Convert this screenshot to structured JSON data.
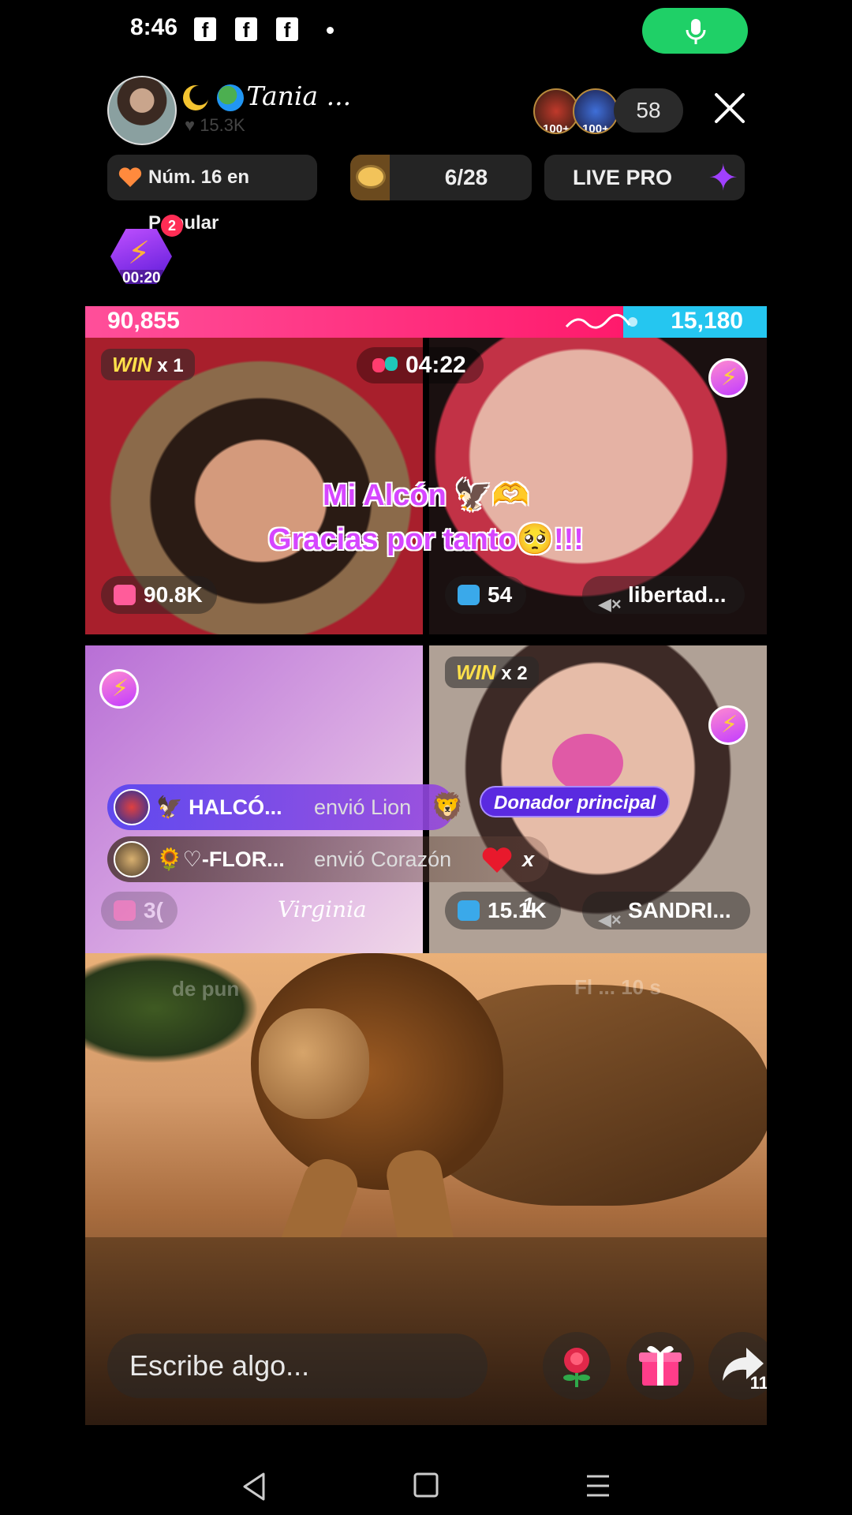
{
  "status_bar": {
    "time": "8:46",
    "notification_icons": [
      "f",
      "f",
      "f"
    ]
  },
  "host": {
    "name": "Tania ...",
    "likes": "15.3K",
    "viewer_badges": [
      "100+",
      "100+"
    ],
    "viewer_count": "58"
  },
  "pills": {
    "rank": "Núm. 16 en Popular",
    "planet_progress": "6/28",
    "live_pro": "LIVE PRO"
  },
  "boost": {
    "count": "2",
    "timer": "00:20"
  },
  "battle": {
    "score_left": "90,855",
    "score_right": "15,180",
    "timer": "04:22",
    "caption_line1": "Mi Alcón 🦅🫶",
    "caption_line2": "Gracias por tanto🥺!!!",
    "tiles": [
      {
        "win_label": "WIN",
        "win_count": "x 1",
        "coins": "90.8K"
      },
      {
        "coins": "54",
        "mute_name": "libertad..."
      },
      {
        "coins": "3(",
        "name": "Virginia"
      },
      {
        "win_label": "WIN",
        "win_count": "x 2",
        "coins": "15.1K",
        "mute_name": "SANDRI..."
      }
    ]
  },
  "gifts": [
    {
      "user": "🦅 HALCÓ...",
      "action": "envió Lion"
    },
    {
      "user": "🌻♡-FLOR...",
      "action": "envió Corazón",
      "multiplier": "x 1"
    }
  ],
  "donor_badge": "Donador principal",
  "ghost_text": {
    "left": "de pun",
    "right": "Fl ... 10 s"
  },
  "composer": {
    "placeholder": "Escribe algo..."
  },
  "share_count": "11",
  "colors": {
    "accent_green": "#1fd067",
    "score_pink": "#ff1a6c",
    "score_blue": "#25c6f0",
    "caption_purple": "#d646ff"
  },
  "icons": {
    "mic": "mic-icon",
    "close": "close-icon",
    "rose": "rose-icon",
    "gift": "gift-icon",
    "share": "share-icon"
  }
}
